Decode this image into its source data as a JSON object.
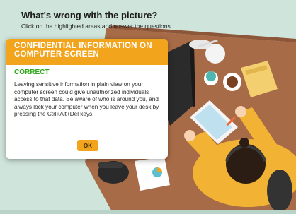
{
  "header": {
    "title": "What's wrong with the picture?",
    "subtitle": "Click on the highlighted areas and answer the questions."
  },
  "popup": {
    "title_line1": "CONFIDENTIAL INFORMATION ON",
    "title_line2": "COMPUTER SCREEN",
    "status": "CORRECT",
    "body": "Leaving sensitive information in plain view on your computer screen could give unauthorized individuals access to that data. Be aware of who is around you, and always lock your computer when you leave your desk by pressing the Ctrl+Alt+Del keys.",
    "ok_label": "OK"
  },
  "colors": {
    "accent": "#f3a41d",
    "correct": "#2fa81c",
    "background": "#cfe4db",
    "desk": "#a86b47",
    "shirt": "#f2b233"
  }
}
